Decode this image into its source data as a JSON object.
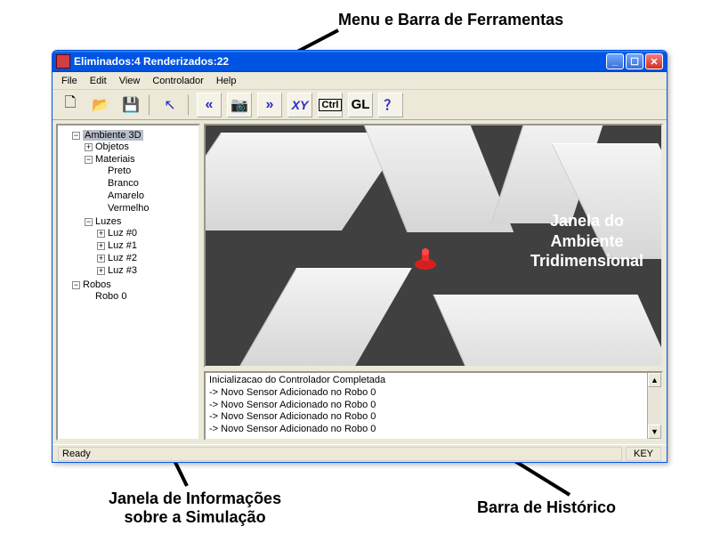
{
  "annotations": {
    "top": "Menu e Barra de Ferramentas",
    "bottom_left_1": "Janela de Informações",
    "bottom_left_2": "sobre a Simulação",
    "bottom_right": "Barra de Histórico",
    "viewport_1": "Janela do",
    "viewport_2": "Ambiente",
    "viewport_3": "Tridimensional"
  },
  "window": {
    "title": "Eliminados:4  Renderizados:22",
    "controls": {
      "min": "_",
      "max": "☐",
      "close": "✕"
    }
  },
  "menubar": [
    "File",
    "Edit",
    "View",
    "Controlador",
    "Help"
  ],
  "toolbar": {
    "new": "🗋",
    "open": "📂",
    "save": "💾",
    "pointer": "↖",
    "prev": "«",
    "camera": "📷",
    "next": "»",
    "xy": "XY",
    "ctrl": "Ctrl",
    "gl": "GL",
    "help": "？"
  },
  "tree": {
    "root": "Ambiente 3D",
    "objetos": "Objetos",
    "materiais": "Materiais",
    "mat_items": [
      "Preto",
      "Branco",
      "Amarelo",
      "Vermelho"
    ],
    "luzes": "Luzes",
    "luz_items": [
      "Luz #0",
      "Luz #1",
      "Luz #2",
      "Luz #3"
    ],
    "robos": "Robos",
    "robo_items": [
      "Robo 0"
    ]
  },
  "history": {
    "lines": [
      "Inicializacao do Controlador Completada",
      "-> Novo Sensor Adicionado no Robo 0",
      "-> Novo Sensor Adicionado no Robo 0",
      "-> Novo Sensor Adicionado no Robo 0",
      "-> Novo Sensor Adicionado no Robo 0"
    ]
  },
  "status": {
    "ready": "Ready",
    "key": "KEY"
  }
}
